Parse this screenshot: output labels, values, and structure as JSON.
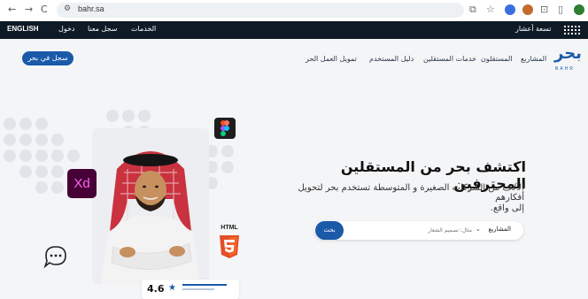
{
  "browser": {
    "url": "bahr.sa",
    "nav_back": "←",
    "nav_forward": "→",
    "nav_reload": "C"
  },
  "topbar": {
    "english": "ENGLISH",
    "login": "دخول",
    "register": "سجل معنا",
    "services": "الخدمات",
    "brand_text": "تسعة أعشار"
  },
  "nav": {
    "logo_ar": "بحر",
    "logo_en": "BAHR",
    "links": [
      "المشاريع",
      "المستقلون",
      "خدمات المستقلين",
      "دليل المستخدم",
      "تمويل العمل الحر"
    ],
    "cta": "سجل في بحر"
  },
  "hero": {
    "title": "اكتشف بحر من المستقلين المحترفين",
    "subtitle_line1": "الآلاف من الشركات الصغيرة و المتوسطة تستخدم بحر لتحويل أفكارهم",
    "subtitle_line2": "إلى واقع."
  },
  "search": {
    "select_value": "المشاريع",
    "placeholder": "مثال: تصميم الشعار",
    "button": "بحث"
  },
  "badges": {
    "xd": "Xd",
    "html": "HTML",
    "rating": "4.6"
  },
  "colors": {
    "primary": "#1a5aa8",
    "topbar": "#0e1a25",
    "background": "#f4f5f7"
  }
}
